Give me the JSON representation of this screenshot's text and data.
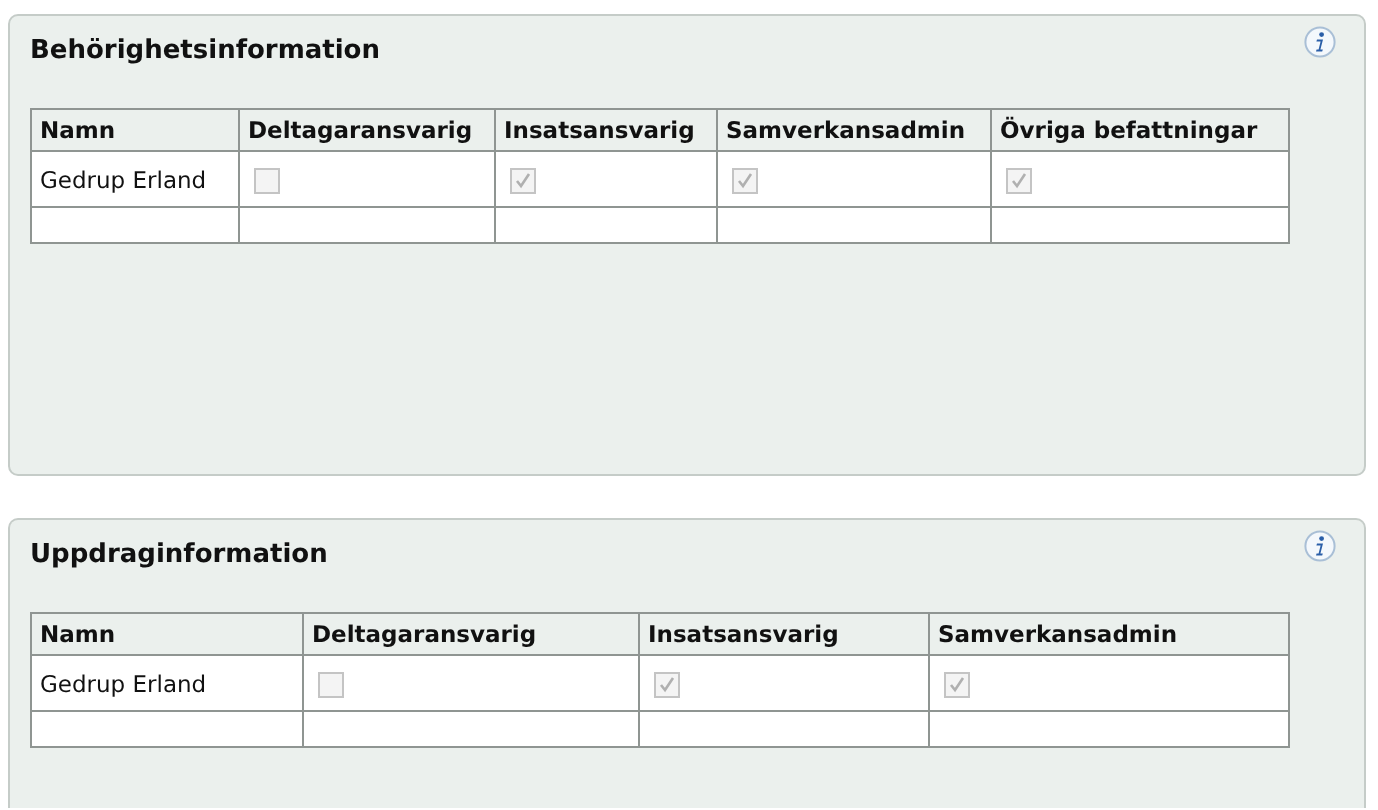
{
  "panels": [
    {
      "title": "Behörighetsinformation",
      "columns": [
        "Namn",
        "Deltagaransvarig",
        "Insatsansvarig",
        "Samverkansadmin",
        "Övriga befattningar"
      ],
      "rows": [
        {
          "name": "Gedrup Erland",
          "checks": [
            {
              "checked": false,
              "disabled": true
            },
            {
              "checked": true,
              "disabled": true
            },
            {
              "checked": true,
              "disabled": true
            },
            {
              "checked": true,
              "disabled": true
            }
          ]
        }
      ]
    },
    {
      "title": "Uppdraginformation",
      "columns": [
        "Namn",
        "Deltagaransvarig",
        "Insatsansvarig",
        "Samverkansadmin"
      ],
      "rows": [
        {
          "name": "Gedrup Erland",
          "checks": [
            {
              "checked": false,
              "disabled": true
            },
            {
              "checked": true,
              "disabled": true
            },
            {
              "checked": true,
              "disabled": true
            }
          ]
        }
      ]
    }
  ]
}
